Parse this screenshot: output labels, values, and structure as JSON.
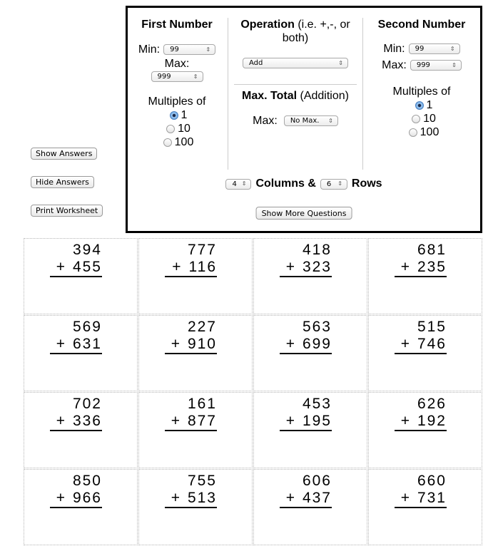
{
  "side_buttons": {
    "show_answers": "Show Answers",
    "hide_answers": "Hide Answers",
    "print_worksheet": "Print Worksheet"
  },
  "panel": {
    "first_number": {
      "title": "First Number",
      "min_label": "Min:",
      "min_value": "99",
      "max_label": "Max:",
      "max_value": "999",
      "multiples_label": "Multiples of",
      "multiples_options": [
        "1",
        "10",
        "100"
      ],
      "multiples_selected": "1"
    },
    "operation": {
      "title": "Operation",
      "title_note": "(i.e. +,-, or both)",
      "value": "Add"
    },
    "max_total": {
      "title": "Max. Total",
      "title_note": "(Addition)",
      "max_label": "Max:",
      "max_value": "No Max."
    },
    "second_number": {
      "title": "Second Number",
      "min_label": "Min:",
      "min_value": "99",
      "max_label": "Max:",
      "max_value": "999",
      "multiples_label": "Multiples of",
      "multiples_options": [
        "1",
        "10",
        "100"
      ],
      "multiples_selected": "1"
    },
    "layout": {
      "columns_value": "4",
      "columns_label": "Columns &",
      "rows_value": "6",
      "rows_label": "Rows"
    },
    "show_more_button": "Show More Questions"
  },
  "worksheet": {
    "operator": "+",
    "problems": [
      {
        "top": "394",
        "bottom": "455"
      },
      {
        "top": "777",
        "bottom": "116"
      },
      {
        "top": "418",
        "bottom": "323"
      },
      {
        "top": "681",
        "bottom": "235"
      },
      {
        "top": "569",
        "bottom": "631"
      },
      {
        "top": "227",
        "bottom": "910"
      },
      {
        "top": "563",
        "bottom": "699"
      },
      {
        "top": "515",
        "bottom": "746"
      },
      {
        "top": "702",
        "bottom": "336"
      },
      {
        "top": "161",
        "bottom": "877"
      },
      {
        "top": "453",
        "bottom": "195"
      },
      {
        "top": "626",
        "bottom": "192"
      },
      {
        "top": "850",
        "bottom": "966"
      },
      {
        "top": "755",
        "bottom": "513"
      },
      {
        "top": "606",
        "bottom": "437"
      },
      {
        "top": "660",
        "bottom": "731"
      }
    ]
  }
}
